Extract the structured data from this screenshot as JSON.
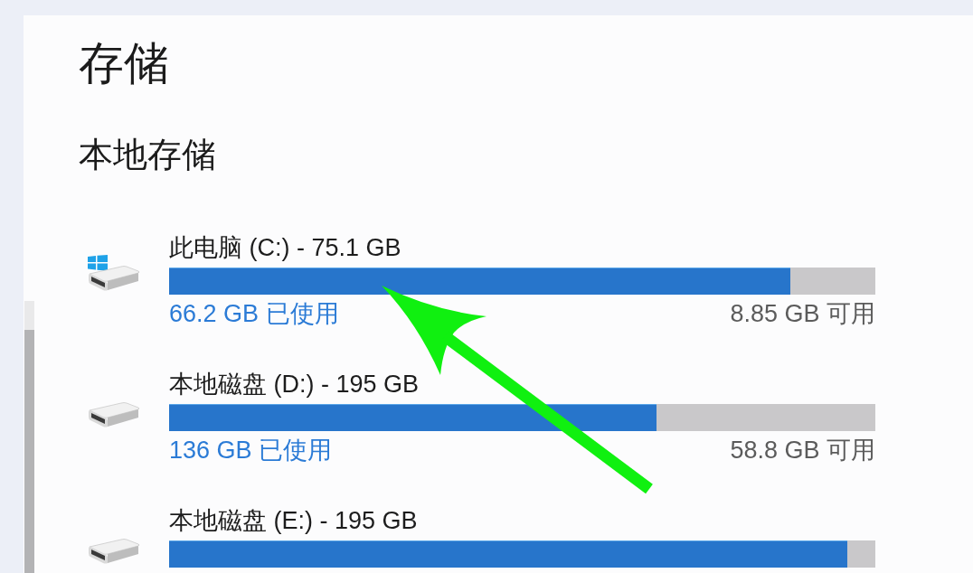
{
  "page": {
    "title": "存储"
  },
  "section": {
    "title": "本地存储"
  },
  "drives": [
    {
      "kind": "system",
      "label": "此电脑 (C:) - 75.1 GB",
      "level": 0.88,
      "used": "66.2 GB 已使用",
      "free": "8.85 GB 可用"
    },
    {
      "kind": "data",
      "label": "本地磁盘 (D:) - 195 GB",
      "level": 0.69,
      "used": "136 GB 已使用",
      "free": "58.8 GB 可用"
    },
    {
      "kind": "data",
      "label": "本地磁盘 (E:) - 195 GB",
      "level": 0.96
    }
  ],
  "annotations": [
    {
      "kind": "arrow"
    }
  ]
}
